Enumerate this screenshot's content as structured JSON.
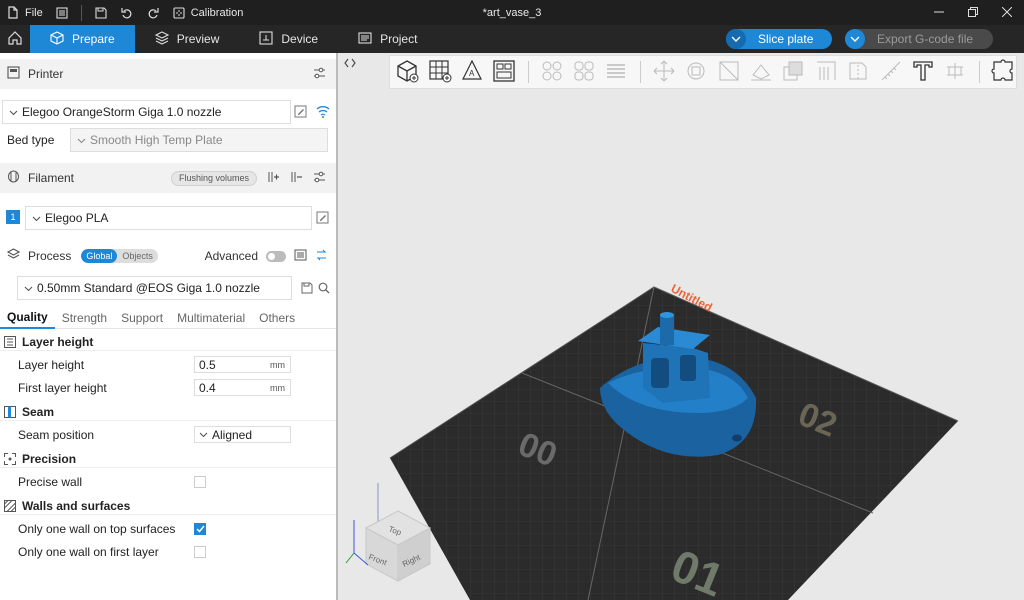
{
  "titlebar": {
    "file_label": "File",
    "calibration_label": "Calibration",
    "window_title": "*art_vase_3"
  },
  "tabs": [
    {
      "label": "Prepare",
      "active": true
    },
    {
      "label": "Preview"
    },
    {
      "label": "Device"
    },
    {
      "label": "Project"
    }
  ],
  "actions": {
    "slice_label": "Slice plate",
    "export_label": "Export G-code file"
  },
  "printer": {
    "section_label": "Printer",
    "name": "Elegoo OrangeStorm Giga 1.0 nozzle",
    "bed_type_label": "Bed type",
    "bed_type_value": "Smooth High Temp Plate"
  },
  "filament": {
    "section_label": "Filament",
    "flushing_label": "Flushing volumes",
    "slot_number": "1",
    "name": "Elegoo PLA"
  },
  "process": {
    "section_label": "Process",
    "global_label": "Global",
    "objects_label": "Objects",
    "advanced_label": "Advanced",
    "profile": "0.50mm Standard @EOS Giga 1.0 nozzle"
  },
  "quality_tabs": [
    "Quality",
    "Strength",
    "Support",
    "Multimaterial",
    "Others"
  ],
  "groups": {
    "layer_height": {
      "title": "Layer height",
      "layer_height_label": "Layer height",
      "layer_height_value": "0.5",
      "first_layer_label": "First layer height",
      "first_layer_value": "0.4",
      "unit": "mm"
    },
    "seam": {
      "title": "Seam",
      "seam_position_label": "Seam position",
      "seam_position_value": "Aligned"
    },
    "precision": {
      "title": "Precision",
      "precise_wall_label": "Precise wall"
    },
    "walls": {
      "title": "Walls and surfaces",
      "top_label": "Only one wall on top surfaces",
      "first_label": "Only one wall on first layer"
    }
  },
  "plate": {
    "name": "Untitled",
    "labels": [
      "00",
      "01",
      "02"
    ]
  },
  "view_cube": {
    "top": "Top",
    "front": "Front",
    "right": "Right"
  },
  "colors": {
    "accent": "#1e88d6",
    "model": "#1f74b8",
    "plate": "#2b2b2b",
    "plate_title": "#e8663a"
  }
}
